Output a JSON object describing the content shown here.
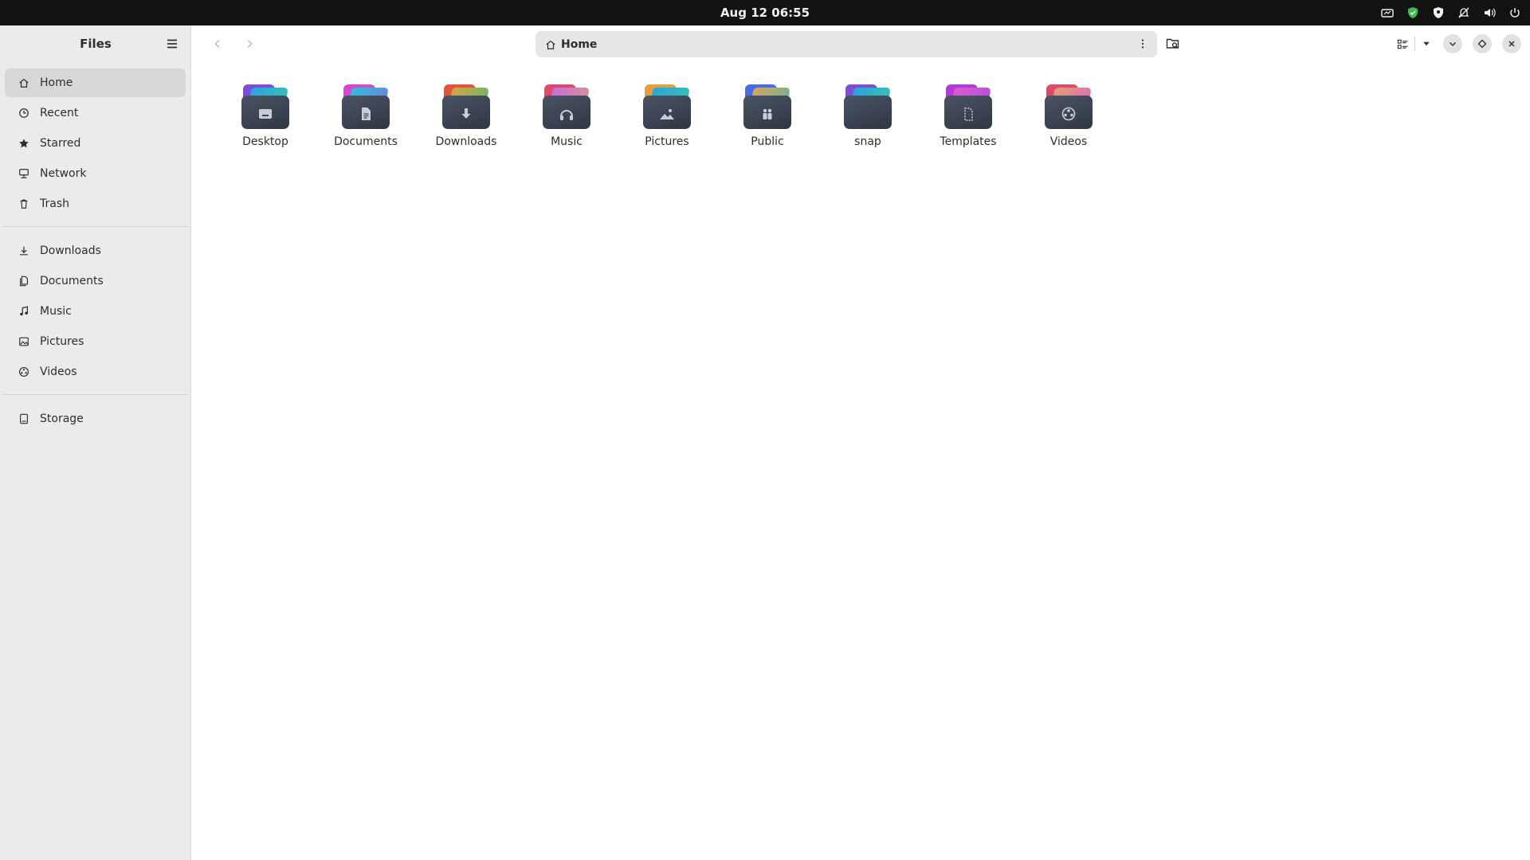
{
  "topbar": {
    "clock": "Aug 12  06:55",
    "tray_icons": [
      "screen-icon",
      "shield-check-icon",
      "shield-icon",
      "notifications-off-icon",
      "volume-icon",
      "power-icon"
    ]
  },
  "sidebar": {
    "title": "Files",
    "places": [
      {
        "label": "Home",
        "icon": "home-icon",
        "active": true
      },
      {
        "label": "Recent",
        "icon": "clock-icon"
      },
      {
        "label": "Starred",
        "icon": "star-icon"
      },
      {
        "label": "Network",
        "icon": "network-icon"
      },
      {
        "label": "Trash",
        "icon": "trash-icon"
      }
    ],
    "bookmarks": [
      {
        "label": "Downloads",
        "icon": "download-icon"
      },
      {
        "label": "Documents",
        "icon": "document-icon"
      },
      {
        "label": "Music",
        "icon": "music-icon"
      },
      {
        "label": "Pictures",
        "icon": "picture-icon"
      },
      {
        "label": "Videos",
        "icon": "video-icon"
      }
    ],
    "devices": [
      {
        "label": "Storage",
        "icon": "drive-icon"
      }
    ]
  },
  "header": {
    "path": "Home"
  },
  "folders": [
    {
      "label": "Desktop",
      "icon": "desktop-icon",
      "back": "#7a4fd6",
      "mid": "#2aa0e0"
    },
    {
      "label": "Documents",
      "icon": "document-icon",
      "back": "#d04bd0",
      "mid": "#2ec1d8"
    },
    {
      "label": "Downloads",
      "icon": "download-icon",
      "back": "#e0563a",
      "mid": "#3cc07a"
    },
    {
      "label": "Music",
      "icon": "headphones-icon",
      "back": "#e04a6a",
      "mid": "#c86be0"
    },
    {
      "label": "Pictures",
      "icon": "landscape-icon",
      "back": "#e0a040",
      "mid": "#2aa0e0"
    },
    {
      "label": "Public",
      "icon": "people-icon",
      "back": "#4b6be0",
      "mid": "#e0a060"
    },
    {
      "label": "snap",
      "icon": "none",
      "back": "#7a4fd6",
      "mid": "#2aa0e0"
    },
    {
      "label": "Templates",
      "icon": "template-icon",
      "back": "#b23ad6",
      "mid": "#e05ad0"
    },
    {
      "label": "Videos",
      "icon": "film-icon",
      "back": "#e04a6a",
      "mid": "#e0a070"
    }
  ]
}
